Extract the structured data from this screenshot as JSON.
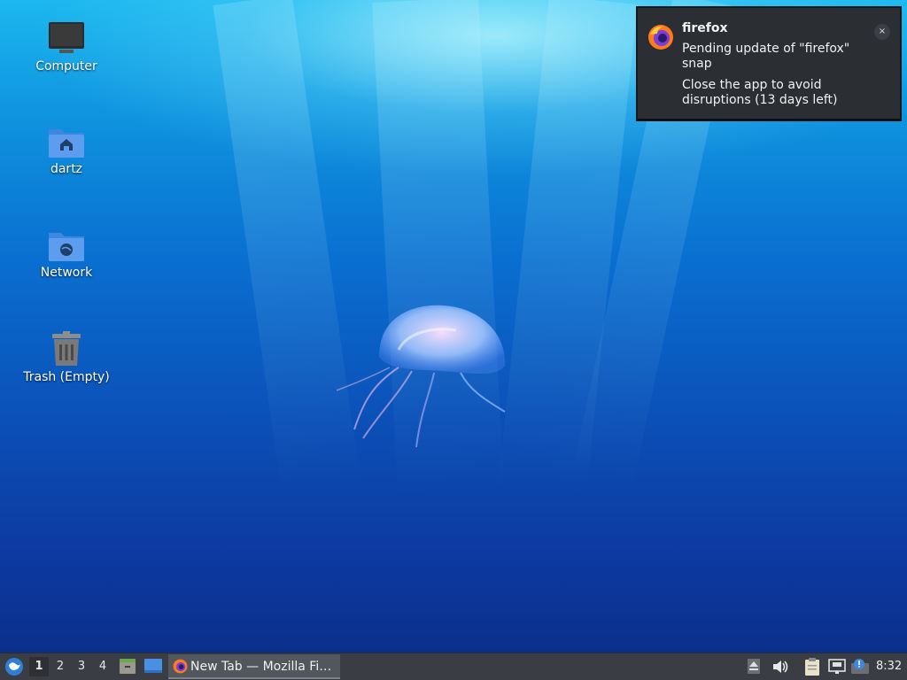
{
  "desktop": {
    "icons": [
      {
        "label": "Computer",
        "icon": "computer-icon"
      },
      {
        "label": "dartz",
        "icon": "home-folder-icon"
      },
      {
        "label": "Network",
        "icon": "network-folder-icon"
      },
      {
        "label": "Trash (Empty)",
        "icon": "trash-icon"
      }
    ]
  },
  "notification": {
    "app": "firefox",
    "summary": "Pending update of \"firefox\" snap",
    "body": "Close the app to avoid disruptions (13 days left)",
    "close_label": "×",
    "icon": "firefox-icon"
  },
  "taskbar": {
    "menu_icon": "whisker-menu-icon",
    "workspaces": [
      "1",
      "2",
      "3",
      "4"
    ],
    "active_workspace": "1",
    "launchers": [
      "file-manager-icon",
      "show-desktop-icon"
    ],
    "tasks": [
      {
        "label": "New Tab — Mozilla Fi…",
        "icon": "firefox-icon"
      }
    ],
    "tray": [
      "eject-icon",
      "volume-icon",
      "clipboard-icon",
      "network-wired-icon",
      "update-notifier-icon"
    ],
    "clock": "8:32"
  },
  "colors": {
    "taskbar_bg": "#3a3d43",
    "notification_bg": "#2b2e33",
    "accent_blue": "#3f86e0"
  }
}
